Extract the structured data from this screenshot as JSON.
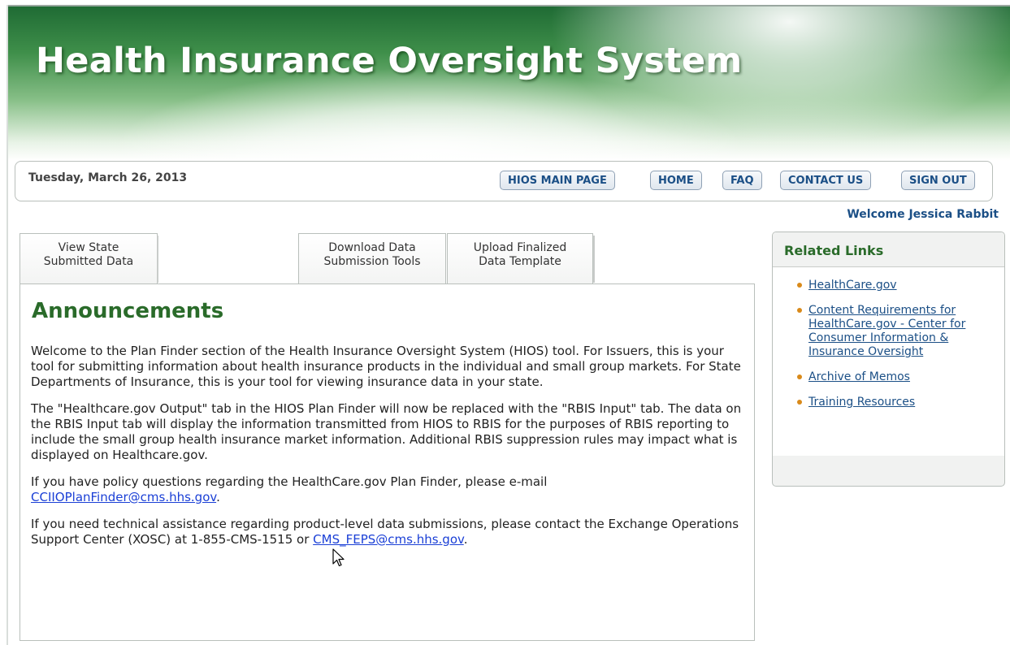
{
  "header": {
    "title": "Health Insurance Oversight System"
  },
  "toolbar": {
    "date": "Tuesday, March 26, 2013",
    "buttons": [
      "HIOS MAIN PAGE",
      "HOME",
      "FAQ",
      "CONTACT US",
      "SIGN OUT"
    ]
  },
  "welcome": "Welcome Jessica Rabbit",
  "tabs": [
    {
      "line1": "View State",
      "line2": "Submitted Data"
    },
    {
      "line1": "Download Data",
      "line2": "Submission Tools"
    },
    {
      "line1": "Upload Finalized",
      "line2": "Data Template"
    }
  ],
  "announcements": {
    "title": "Announcements",
    "p1": "Welcome to the Plan Finder section of the Health Insurance Oversight System (HIOS) tool. For Issuers, this is your tool for submitting information about health insurance products in the individual and small group markets. For State Departments of Insurance, this is your tool for viewing insurance data in your state.",
    "p2": "The \"Healthcare.gov Output\" tab in the HIOS Plan Finder will now be replaced with the \"RBIS Input\" tab. The data on the RBIS Input tab will display the information transmitted from HIOS to RBIS for the purposes of RBIS reporting to include the small group health insurance market information. Additional RBIS suppression rules may impact what is displayed on Healthcare.gov.",
    "p3_text": "If you have policy questions regarding the HealthCare.gov Plan Finder, please e-mail ",
    "p3_link": "CCIIOPlanFinder@cms.hhs.gov",
    "p3_end": ".",
    "p4_text": "If you need technical assistance regarding product-level data submissions, please contact the Exchange Operations Support Center (XOSC) at 1-855-CMS-1515 or ",
    "p4_link": "CMS_FEPS@cms.hhs.gov",
    "p4_end": "."
  },
  "related": {
    "title": "Related Links",
    "links": [
      "HealthCare.gov",
      "Content Requirements for HealthCare.gov - Center for Consumer Information & Insurance Oversight",
      "Archive of Memos",
      "Training Resources"
    ]
  }
}
